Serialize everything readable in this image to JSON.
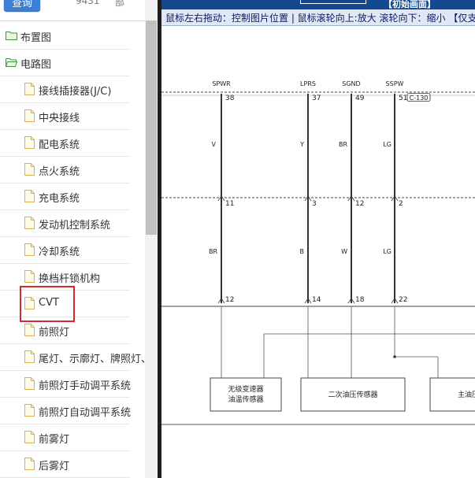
{
  "topbar": {
    "query_label": "查询",
    "code_text": "9431",
    "part_text": "部"
  },
  "tree": {
    "folders": [
      {
        "label": "布置图"
      },
      {
        "label": "电路图"
      }
    ],
    "items": [
      {
        "label": "接线插接器(J/C)"
      },
      {
        "label": "中央接线"
      },
      {
        "label": "配电系统"
      },
      {
        "label": "点火系统"
      },
      {
        "label": "充电系统"
      },
      {
        "label": "发动机控制系统"
      },
      {
        "label": "冷却系统"
      },
      {
        "label": "换档杆锁机构"
      },
      {
        "label": "CVT",
        "selected": true
      },
      {
        "label": "前照灯"
      },
      {
        "label": "尾灯、示廓灯、牌照灯、"
      },
      {
        "label": "前照灯手动调平系统"
      },
      {
        "label": "前照灯自动调平系统"
      },
      {
        "label": "前雾灯"
      },
      {
        "label": "后雾灯"
      }
    ]
  },
  "viewer": {
    "header_text": "【初始画面】",
    "hint_text": "鼠标左右拖动：控制图片位置 | 鼠标滚轮向上:放大  滚轮向下：缩小 【仅支"
  },
  "diagram": {
    "signals": [
      "SPWR",
      "LPRS",
      "SGND",
      "SSPW"
    ],
    "top_pins": [
      "38",
      "37",
      "49",
      "51"
    ],
    "connector_tag": "C-130",
    "upper_colors": [
      "V",
      "Y",
      "BR",
      "LG"
    ],
    "mid_pins": [
      "11",
      "3",
      "12",
      "2"
    ],
    "lower_colors": [
      "BR",
      "B",
      "W",
      "LG"
    ],
    "bottom_pins": [
      "12",
      "14",
      "18",
      "22"
    ],
    "components": {
      "cvt_temp_line1": "无级变速器",
      "cvt_temp_line2": "油温传感器",
      "secondary_pressure": "二次油压传感器",
      "main_pressure": "主油压"
    }
  },
  "colors": {
    "accent": "#13498f",
    "highlight": "#d9272e",
    "hint_bg": "#dfe8f4"
  }
}
